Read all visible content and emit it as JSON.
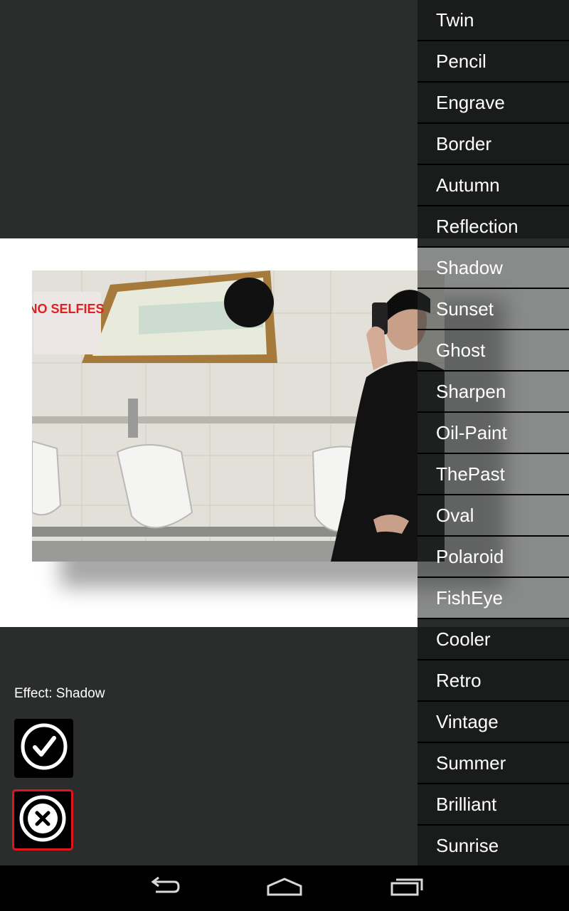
{
  "preview": {
    "photo_sign": "NO SELFIES"
  },
  "effects": [
    "Twin",
    "Pencil",
    "Engrave",
    "Border",
    "Autumn",
    "Reflection",
    "Shadow",
    "Sunset",
    "Ghost",
    "Sharpen",
    "Oil-Paint",
    "ThePast",
    "Oval",
    "Polaroid",
    "FishEye",
    "Cooler",
    "Retro",
    "Vintage",
    "Summer",
    "Brilliant",
    "Sunrise"
  ],
  "status": {
    "effect_label": "Effect: Shadow"
  },
  "actions": {
    "confirm_icon": "check-circle-icon",
    "cancel_icon": "close-circle-icon"
  },
  "navbar": {
    "back_icon": "back-icon",
    "home_icon": "home-icon",
    "recents_icon": "recents-icon"
  },
  "colors": {
    "background": "#2b2d2c",
    "selection_outline": "#e0151b",
    "list_background": "#191b1a"
  }
}
